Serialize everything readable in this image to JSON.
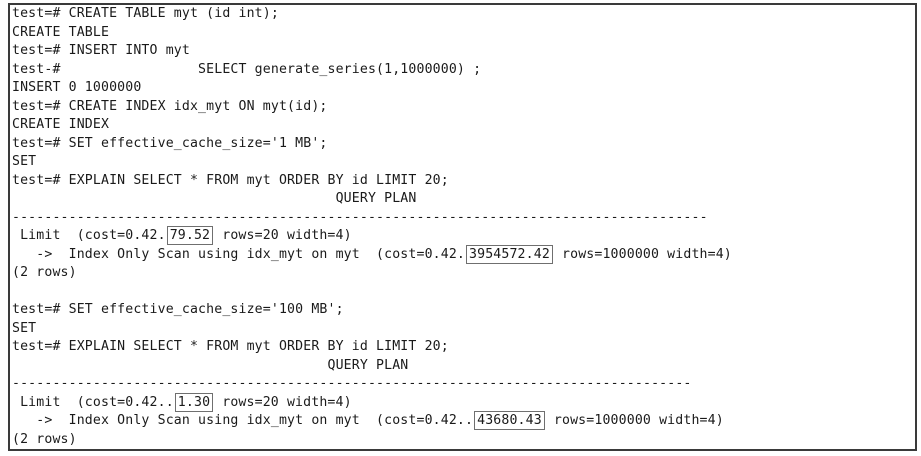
{
  "terminal": {
    "lines": [
      {
        "text": "test=# CREATE TABLE myt (id int);"
      },
      {
        "text": "CREATE TABLE"
      },
      {
        "text": "test=# INSERT INTO myt"
      },
      {
        "text": "test-#                 SELECT generate_series(1,1000000) ;"
      },
      {
        "text": "INSERT 0 1000000"
      },
      {
        "text": "test=# CREATE INDEX idx_myt ON myt(id);"
      },
      {
        "text": "CREATE INDEX"
      },
      {
        "text": "test=# SET effective_cache_size='1 MB';"
      },
      {
        "text": "SET"
      },
      {
        "text": "test=# EXPLAIN SELECT * FROM myt ORDER BY id LIMIT 20;"
      },
      {
        "text": "                                        QUERY PLAN"
      },
      {
        "text": "--------------------------------------------------------------------------------------"
      },
      {
        "pre": " Limit  (cost=0.42.",
        "hl": "79.52",
        "post": " rows=20 width=4)"
      },
      {
        "pre": "   ->  Index Only Scan using idx_myt on myt  (cost=0.42.",
        "hl": "3954572.42",
        "post": " rows=1000000 width=4)"
      },
      {
        "text": "(2 rows)"
      },
      {
        "text": ""
      },
      {
        "text": "test=# SET effective_cache_size='100 MB';"
      },
      {
        "text": "SET"
      },
      {
        "text": "test=# EXPLAIN SELECT * FROM myt ORDER BY id LIMIT 20;"
      },
      {
        "text": "                                       QUERY PLAN"
      },
      {
        "text": "------------------------------------------------------------------------------------"
      },
      {
        "pre": " Limit  (cost=0.42..",
        "hl": "1.30",
        "post": " rows=20 width=4)"
      },
      {
        "pre": "   ->  Index Only Scan using idx_myt on myt  (cost=0.42..",
        "hl": "43680.43",
        "post": " rows=1000000 width=4)"
      },
      {
        "text": "(2 rows)"
      }
    ]
  }
}
